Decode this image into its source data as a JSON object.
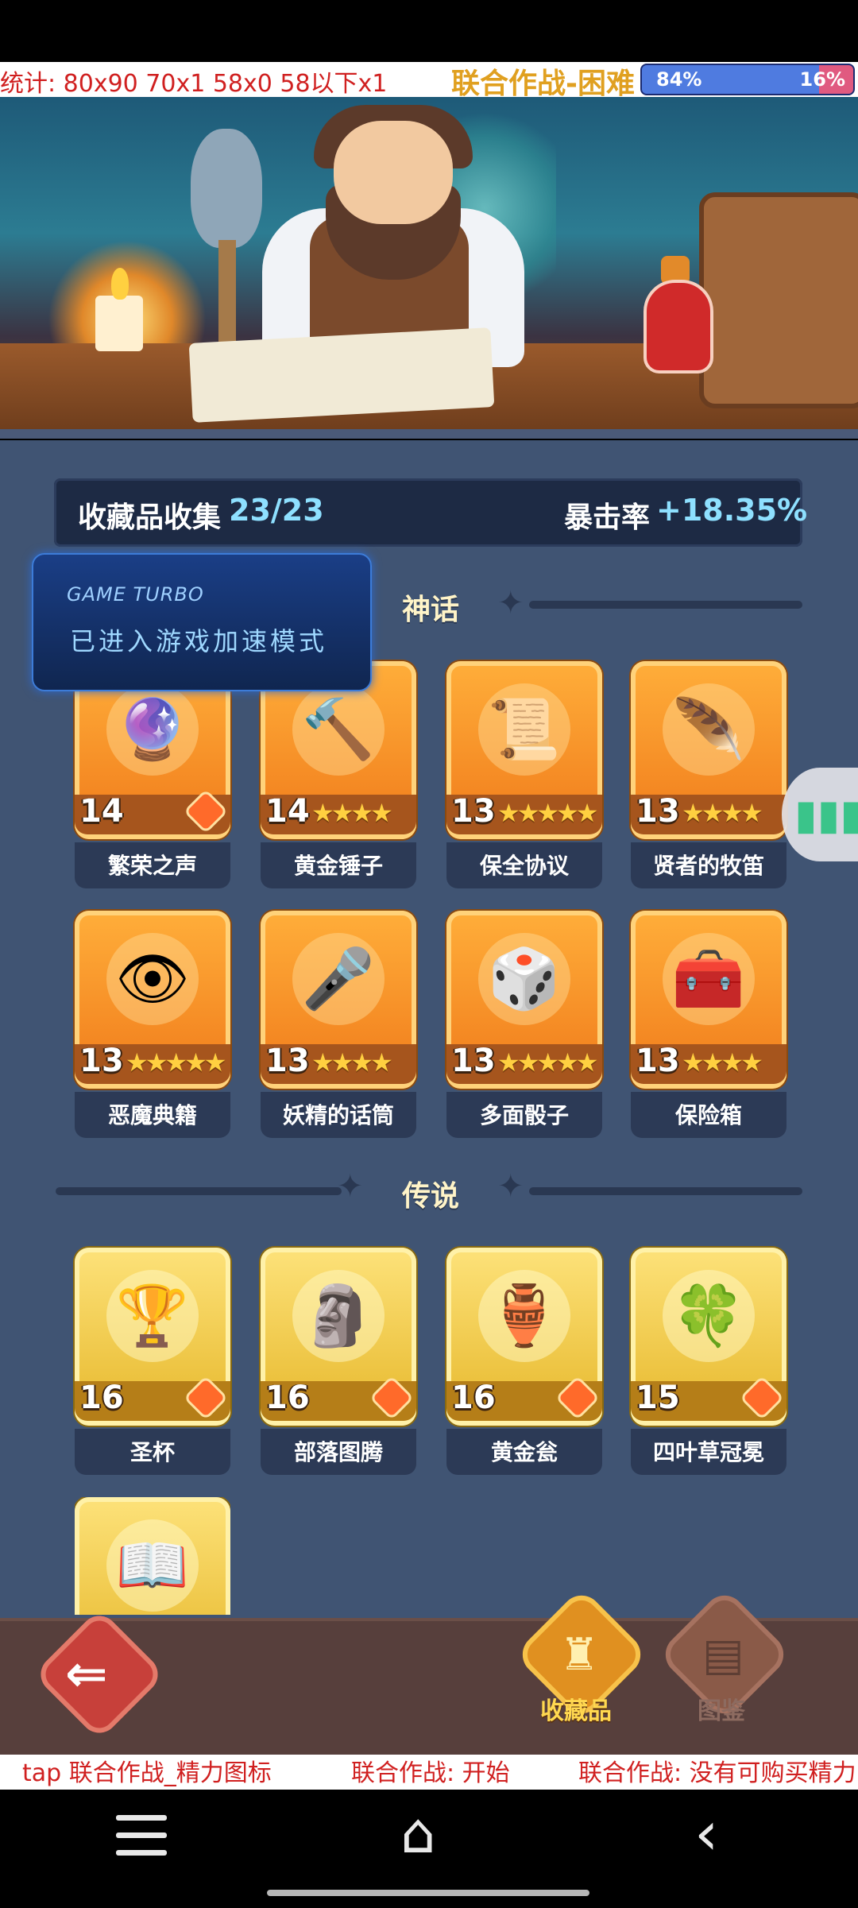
{
  "debug_top": {
    "stats": "统计: 80x90 70x1 58x0 58以下x1",
    "mode": "联合作战-困难",
    "progress_left": "84%",
    "progress_right": "16%",
    "progress_value": 0.84
  },
  "collection": {
    "label": "收藏品收集",
    "count": "23/23",
    "crit_label": "暴击率",
    "crit_value": "+18.35%"
  },
  "sections": {
    "myth": "神话",
    "legend": "传说"
  },
  "turbo": {
    "title": "GAME TURBO",
    "message": "已进入游戏加速模式"
  },
  "myth_cards": [
    {
      "name": "繁荣之声",
      "level": "14",
      "stars": "",
      "icon": "bell-orb-icon"
    },
    {
      "name": "黄金锤子",
      "level": "14",
      "stars": "★★★★",
      "icon": "hammer-icon"
    },
    {
      "name": "保全协议",
      "level": "13",
      "stars": "★★★★★",
      "icon": "contract-icon"
    },
    {
      "name": "贤者的牧笛",
      "level": "13",
      "stars": "★★★★",
      "icon": "flute-icon"
    },
    {
      "name": "恶魔典籍",
      "level": "13",
      "stars": "★★★★★",
      "icon": "demon-book-icon"
    },
    {
      "name": "妖精的话筒",
      "level": "13",
      "stars": "★★★★",
      "icon": "fairy-mic-icon"
    },
    {
      "name": "多面骰子",
      "level": "13",
      "stars": "★★★★★",
      "icon": "dice-icon"
    },
    {
      "name": "保险箱",
      "level": "13",
      "stars": "★★★★",
      "icon": "treasure-chest-icon"
    }
  ],
  "legend_cards": [
    {
      "name": "圣杯",
      "level": "16",
      "icon": "grail-icon"
    },
    {
      "name": "部落图腾",
      "level": "16",
      "icon": "totem-icon"
    },
    {
      "name": "黄金瓮",
      "level": "16",
      "icon": "golden-urn-icon"
    },
    {
      "name": "四叶草冠冕",
      "level": "15",
      "icon": "clover-crown-icon"
    },
    {
      "name": "",
      "level": "",
      "icon": "open-book-icon"
    }
  ],
  "nav": {
    "collection_label": "收藏品",
    "atlas_label": "图鉴"
  },
  "debug_bottom": {
    "left": "tap 联合作战_精力图标",
    "middle": "联合作战: 开始",
    "right": "联合作战: 没有可购买精力"
  },
  "colors": {
    "panel_bg": "#405473",
    "myth_card": "#f07a1a",
    "legend_card": "#e6b72a",
    "highlight_blue": "#8ee0ff",
    "debug_red": "#d02020"
  }
}
